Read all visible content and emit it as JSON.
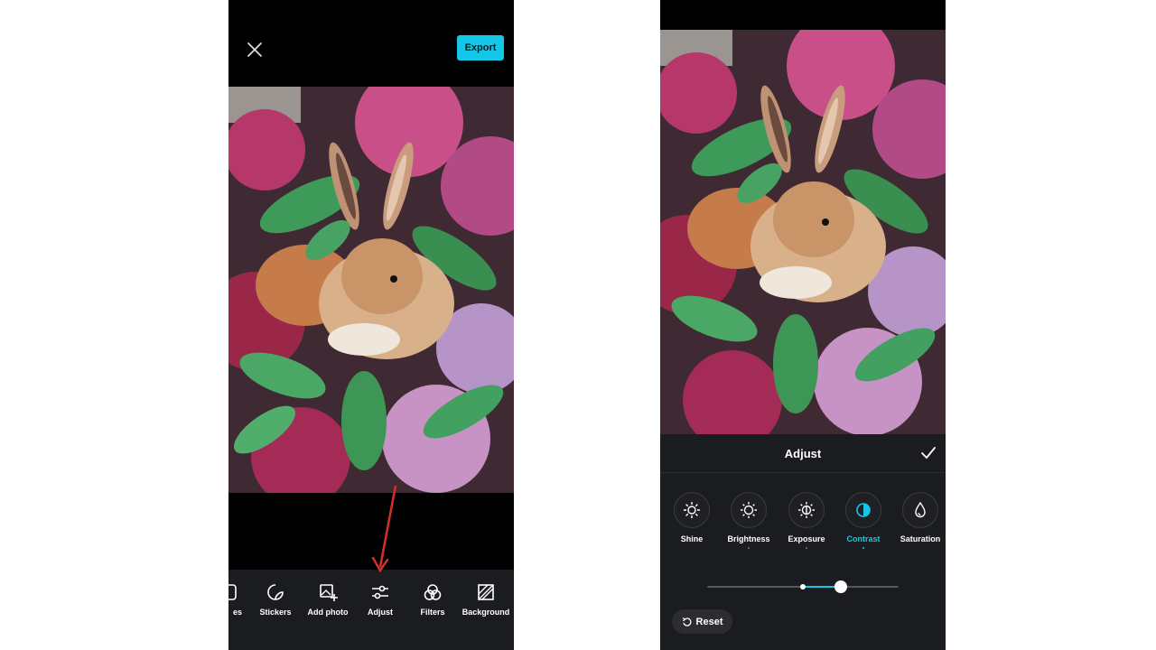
{
  "editor": {
    "export_label": "Export",
    "tools": [
      {
        "label": "es"
      },
      {
        "label": "Stickers"
      },
      {
        "label": "Add photo"
      },
      {
        "label": "Adjust"
      },
      {
        "label": "Filters"
      },
      {
        "label": "Background"
      }
    ],
    "accent_color": "#12c8e6",
    "annotation_arrow_color": "#d0312d"
  },
  "adjust_panel": {
    "title": "Adjust",
    "options": [
      {
        "label": "Shine",
        "icon": "shine-icon"
      },
      {
        "label": "Brightness",
        "icon": "brightness-icon"
      },
      {
        "label": "Exposure",
        "icon": "exposure-icon"
      },
      {
        "label": "Contrast",
        "icon": "contrast-icon",
        "active": true
      },
      {
        "label": "Saturation",
        "icon": "saturation-icon"
      }
    ],
    "slider_value_percent": 70,
    "reset_label": "Reset"
  }
}
